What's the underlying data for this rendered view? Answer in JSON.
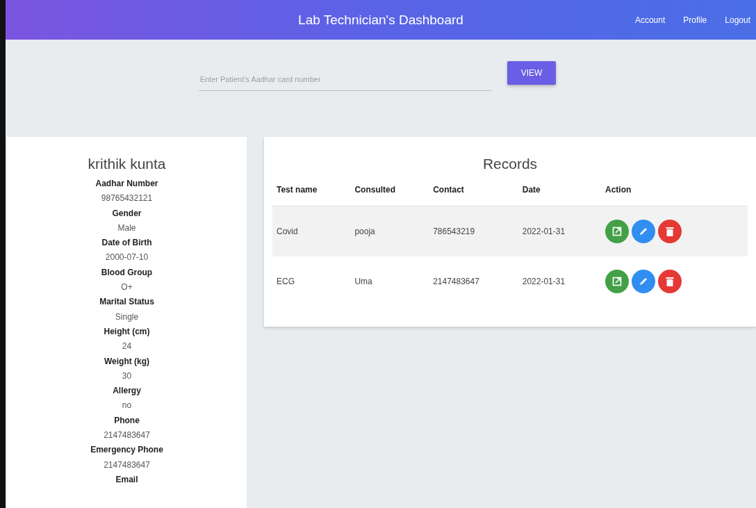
{
  "header": {
    "title": "Lab Technician's Dashboard",
    "links": [
      "Account",
      "Profile",
      "Logout"
    ]
  },
  "search": {
    "placeholder": "Enter Patient's Aadhar card number",
    "button": "VIEW"
  },
  "patient": {
    "name": "krithik kunta",
    "fields": [
      {
        "label": "Aadhar Number",
        "value": "98765432121"
      },
      {
        "label": "Gender",
        "value": "Male"
      },
      {
        "label": "Date of Birth",
        "value": "2000-07-10"
      },
      {
        "label": "Blood Group",
        "value": "O+"
      },
      {
        "label": "Marital Status",
        "value": "Single"
      },
      {
        "label": "Height (cm)",
        "value": "24"
      },
      {
        "label": "Weight (kg)",
        "value": "30"
      },
      {
        "label": "Allergy",
        "value": "no"
      },
      {
        "label": "Phone",
        "value": "2147483647"
      },
      {
        "label": "Emergency Phone",
        "value": "2147483647"
      },
      {
        "label": "Email"
      }
    ]
  },
  "records": {
    "title": "Records",
    "columns": [
      "Test name",
      "Consulted",
      "Contact",
      "Date",
      "Action"
    ],
    "rows": [
      {
        "cells": [
          "Covid",
          "pooja",
          "786543219",
          "2022-01-31"
        ],
        "highlighted": true,
        "actions": [
          {
            "kind": "open"
          },
          {
            "kind": "edit"
          },
          {
            "kind": "delete"
          }
        ]
      },
      {
        "cells": [
          "ECG",
          "Uma",
          "2147483647",
          "2022-01-31"
        ],
        "highlighted": false,
        "actions": [
          {
            "kind": "open"
          },
          {
            "kind": "edit"
          },
          {
            "kind": "delete"
          }
        ]
      }
    ]
  }
}
